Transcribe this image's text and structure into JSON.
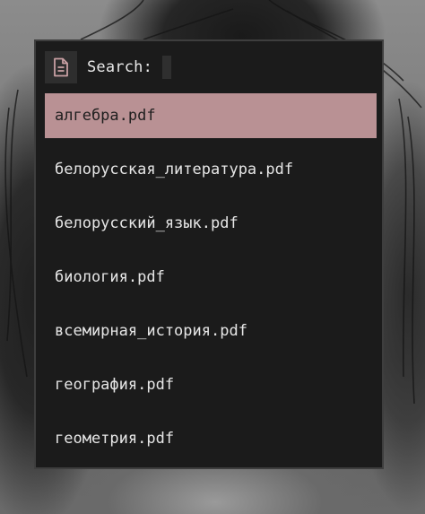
{
  "launcher": {
    "icon": "document-icon",
    "search_label": "Search:",
    "search_query": "",
    "accent_color": "#b99194",
    "selected_index": 0,
    "items": [
      {
        "label": "алгебра.pdf"
      },
      {
        "label": "белорусская_литература.pdf"
      },
      {
        "label": "белорусский_язык.pdf"
      },
      {
        "label": "биология.pdf"
      },
      {
        "label": "всемирная_история.pdf"
      },
      {
        "label": "география.pdf"
      },
      {
        "label": "геометрия.pdf"
      }
    ]
  }
}
